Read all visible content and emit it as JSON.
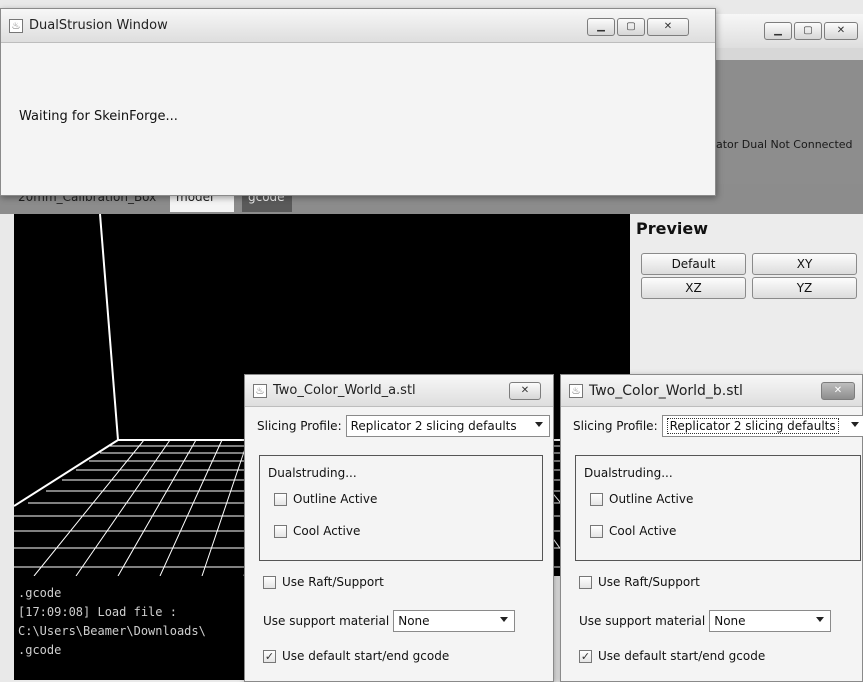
{
  "main_app": {
    "status": "ator Dual Not Connected",
    "tabs": [
      {
        "label": "20mm_Calibration_Box"
      },
      {
        "label": "model"
      },
      {
        "label": "gcode"
      }
    ],
    "preview": {
      "title": "Preview",
      "buttons": [
        "Default",
        "XY",
        "XZ",
        "YZ"
      ]
    },
    "console_lines": [
      ".gcode",
      "[17:09:08] Load file :",
      "C:\\Users\\Beamer\\Downloads\\",
      ".gcode"
    ]
  },
  "dual_window": {
    "title": "DualStrusion Window",
    "message": "Waiting for SkeinForge..."
  },
  "stl_windows": [
    {
      "title": "Two_Color_World_a.stl",
      "slicing_profile_label": "Slicing Profile:",
      "slicing_profile_value": "Replicator 2 slicing defaults",
      "group_label": "Dualstruding...",
      "outline_label": "Outline Active",
      "cool_label": "Cool Active",
      "raft_label": "Use Raft/Support",
      "support_label": "Use support material",
      "support_value": "None",
      "gcode_label": "Use default start/end gcode"
    },
    {
      "title": "Two_Color_World_b.stl",
      "slicing_profile_label": "Slicing Profile:",
      "slicing_profile_value": "Replicator 2 slicing defaults",
      "group_label": "Dualstruding...",
      "outline_label": "Outline Active",
      "cool_label": "Cool Active",
      "raft_label": "Use Raft/Support",
      "support_label": "Use support material",
      "support_value": "None",
      "gcode_label": "Use default start/end gcode"
    }
  ],
  "window_controls": {
    "minimize": "▁",
    "maximize": "▢",
    "close": "✕",
    "java": "♨"
  }
}
